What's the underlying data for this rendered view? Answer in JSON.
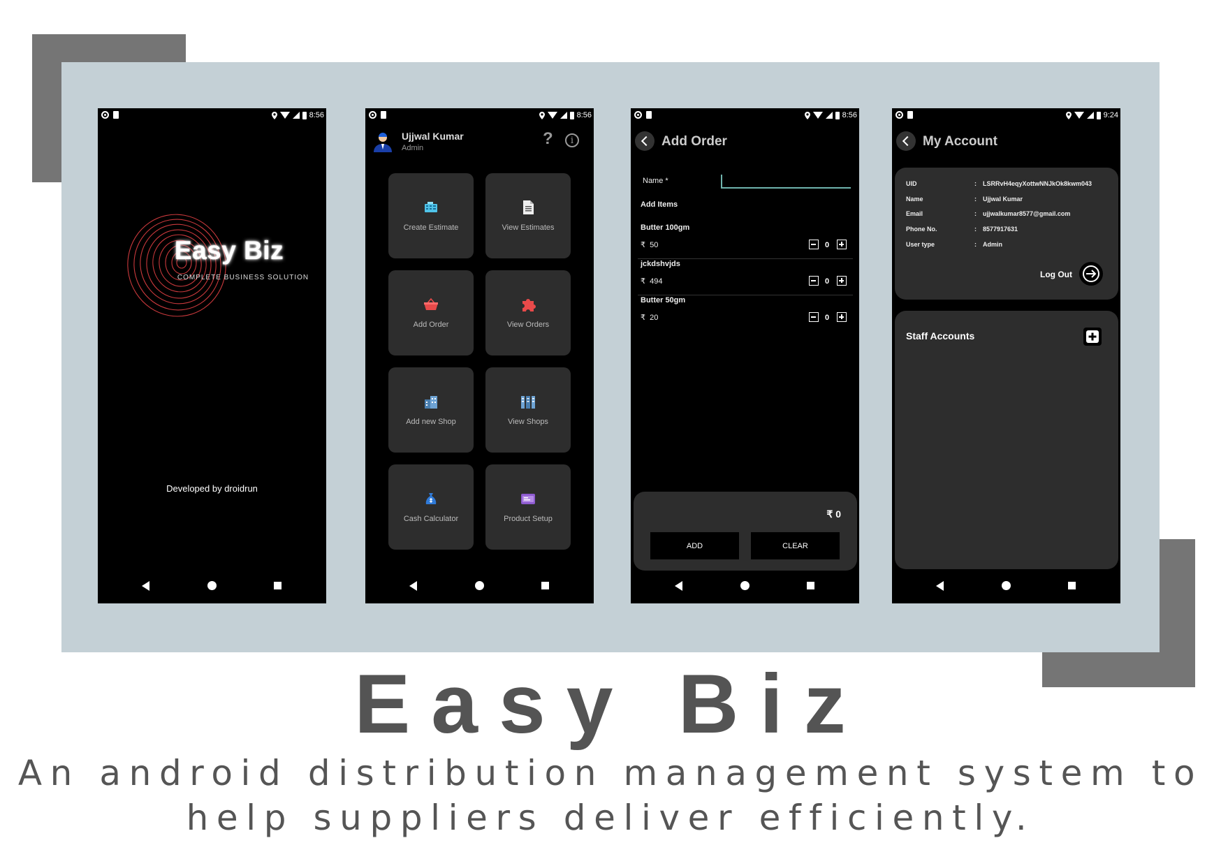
{
  "colors": {
    "panel": "#c4d0d6",
    "deco": "#757575",
    "tile": "#2d2d2d",
    "accent_input": "#6fb3ad"
  },
  "splash": {
    "time": "8:56",
    "logo_title": "Easy Biz",
    "logo_subtitle": "COMPLETE BUSINESS SOLUTION",
    "developer": "Developed by droidrun"
  },
  "dashboard": {
    "time": "8:56",
    "user_name": "Ujjwal Kumar",
    "user_role": "Admin",
    "help": "?",
    "info": "i",
    "tiles": [
      {
        "label": "Create Estimate",
        "icon": "cash-register-icon"
      },
      {
        "label": "View Estimates",
        "icon": "document-icon"
      },
      {
        "label": "Add Order",
        "icon": "basket-icon"
      },
      {
        "label": "View Orders",
        "icon": "puzzle-icon"
      },
      {
        "label": "Add new Shop",
        "icon": "building-icon"
      },
      {
        "label": "View Shops",
        "icon": "buildings-icon"
      },
      {
        "label": "Cash Calculator",
        "icon": "money-bag-icon"
      },
      {
        "label": "Product Setup",
        "icon": "product-box-icon"
      }
    ]
  },
  "order": {
    "time": "8:56",
    "title": "Add Order",
    "name_label": "Name *",
    "name_value": "",
    "add_items_label": "Add Items",
    "currency": "₹",
    "items": [
      {
        "name": "Butter 100gm",
        "price": "50",
        "qty": "0"
      },
      {
        "name": "jckdshvjds",
        "price": "494",
        "qty": "0"
      },
      {
        "name": "Butter 50gm",
        "price": "20",
        "qty": "0"
      }
    ],
    "total": "₹  0",
    "add_button": "ADD",
    "clear_button": "CLEAR"
  },
  "account": {
    "time": "9:24",
    "title": "My Account",
    "fields": [
      {
        "key": "UID",
        "value": "LSRRvH4eqyXottwNNJkOk8kwm043"
      },
      {
        "key": "Name",
        "value": "Ujjwal Kumar"
      },
      {
        "key": "Email",
        "value": "ujjwalkumar8577@gmail.com"
      },
      {
        "key": "Phone No.",
        "value": "8577917631"
      },
      {
        "key": "User type",
        "value": "Admin"
      }
    ],
    "colon": ":",
    "logout_label": "Log Out",
    "staff_label": "Staff Accounts"
  },
  "footer": {
    "title": "Easy Biz",
    "tagline_line1": "An android distribution management system to",
    "tagline_line2": "help suppliers deliver efficiently."
  }
}
